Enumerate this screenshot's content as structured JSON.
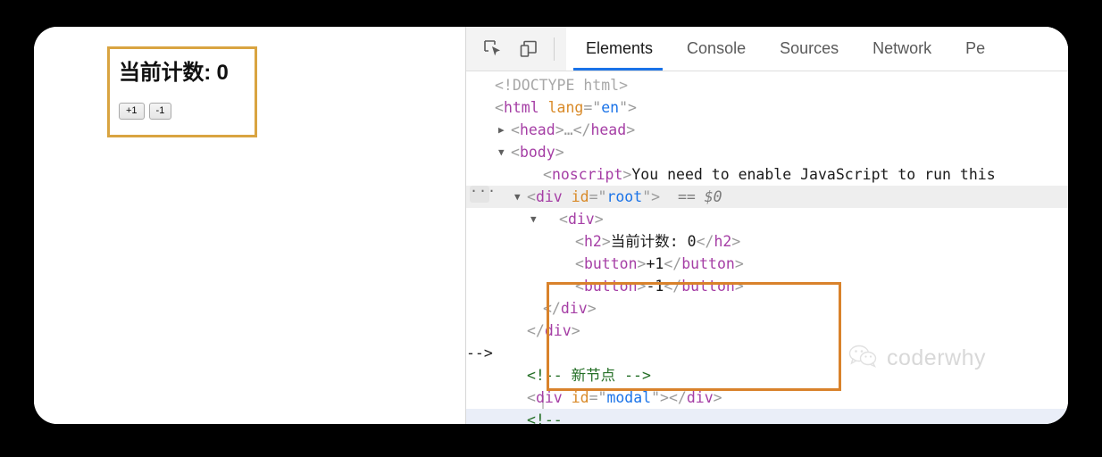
{
  "preview": {
    "counter": {
      "heading": "当前计数: 0",
      "increment_label": "+1",
      "decrement_label": "-1",
      "border_color": "#d9a441"
    }
  },
  "devtools": {
    "toolbar": {
      "icons": [
        {
          "name": "inspect-element-icon",
          "title": "Inspect"
        },
        {
          "name": "device-toolbar-icon",
          "title": "Toggle device toolbar"
        }
      ],
      "tabs": [
        {
          "label": "Elements",
          "active": true
        },
        {
          "label": "Console",
          "active": false
        },
        {
          "label": "Sources",
          "active": false
        },
        {
          "label": "Network",
          "active": false
        },
        {
          "label": "Pe",
          "active": false
        }
      ],
      "active_tab_color": "#1a73e8"
    },
    "dom_tree": {
      "highlight_color": "#d9822b",
      "selected_row_color": "#eaeef8",
      "rows": [
        {
          "id": "doctype",
          "text": "<!DOCTYPE html>"
        },
        {
          "id": "html-open",
          "tag": "html",
          "attr": "lang",
          "value": "en"
        },
        {
          "id": "head",
          "text": "<head>…</head>"
        },
        {
          "id": "body-open",
          "text": "<body>"
        },
        {
          "id": "noscript",
          "tag": "noscript",
          "text": "You need to enable JavaScript to run this"
        },
        {
          "id": "root-div",
          "tag": "div",
          "attr": "id",
          "value": "root",
          "suffix": "== $0"
        },
        {
          "id": "inner-div",
          "text": "<div>"
        },
        {
          "id": "h2",
          "tag": "h2",
          "text": "当前计数: 0"
        },
        {
          "id": "button-plus",
          "tag": "button",
          "text": "+1"
        },
        {
          "id": "button-minus",
          "tag": "button",
          "text": "-1"
        },
        {
          "id": "inner-div-close",
          "text": "</div>"
        },
        {
          "id": "root-div-close",
          "text": "</div>"
        },
        {
          "id": "comment-new-node",
          "text": "<!-- 新节点 -->"
        },
        {
          "id": "modal-div",
          "tag": "div",
          "attr": "id",
          "value": "modal"
        },
        {
          "id": "comment-open",
          "text": "<!--"
        }
      ],
      "labels": {
        "doctype": "<!DOCTYPE html>",
        "html_tag": "html",
        "lang_attr": "lang",
        "lang_value": "en",
        "head_collapsed": "…",
        "body_tag": "body",
        "noscript_tag": "noscript",
        "noscript_text": "You need to enable JavaScript to run this",
        "div_tag": "div",
        "id_attr": "id",
        "root_value": "root",
        "modal_value": "modal",
        "selected_marker": "== $0",
        "h2_tag": "h2",
        "h2_text": "当前计数: 0",
        "button_tag": "button",
        "button_plus_text": "+1",
        "button_minus_text": "-1",
        "comment_new_node": "<!-- 新节点 -->",
        "comment_open": "<!--",
        "more_badge": "···"
      }
    }
  },
  "watermark": {
    "text": "coderwhy",
    "icon": "wechat-icon"
  }
}
